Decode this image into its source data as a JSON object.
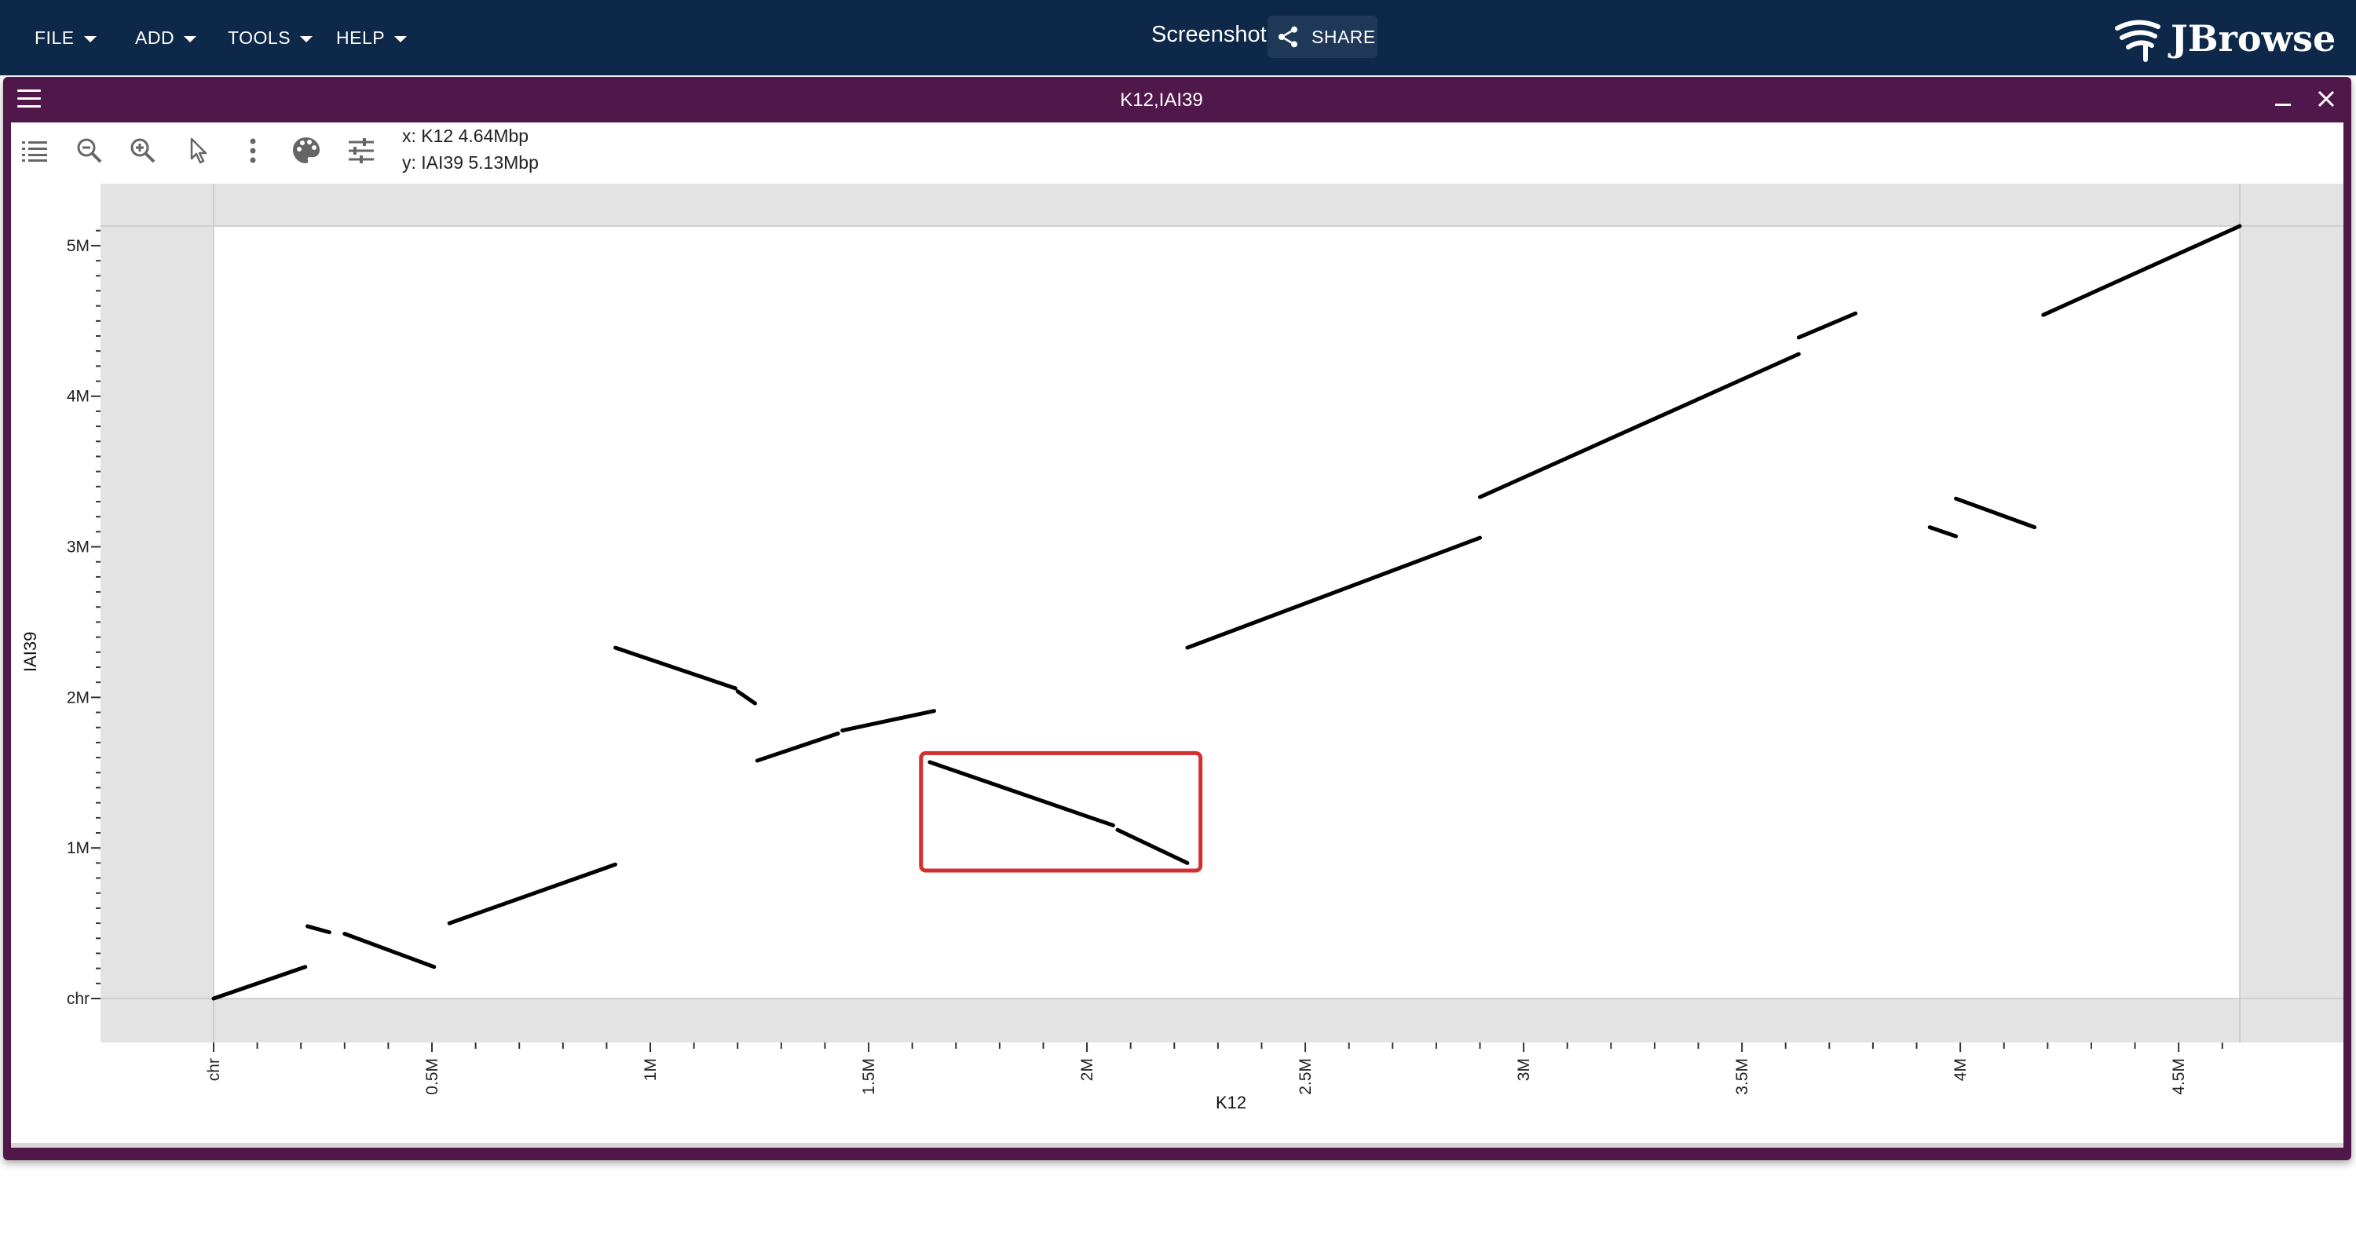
{
  "appbar": {
    "menus": [
      {
        "label": "FILE"
      },
      {
        "label": "ADD"
      },
      {
        "label": "TOOLS"
      },
      {
        "label": "HELP"
      }
    ],
    "session_title": "Screenshot",
    "share_label": "SHARE",
    "logo_text": "JBrowse",
    "background_color": "#0d2849"
  },
  "view": {
    "title": "K12,IAI39",
    "frame_color": "#50184a",
    "toolbar_icons": [
      "track-selector-icon",
      "zoom-out-icon",
      "zoom-in-icon",
      "cursor-mode-icon",
      "more-vert-icon",
      "palette-icon",
      "settings-tune-icon"
    ],
    "coords": {
      "x": "x: K12 4.64Mbp",
      "y": "y: IAI39 5.13Mbp"
    },
    "highlight_color": "#d32f2f"
  },
  "chart_data": {
    "type": "scatter",
    "xlabel": "K12",
    "ylabel": "IAI39",
    "xlim": [
      0,
      4640000
    ],
    "ylim": [
      0,
      5130000
    ],
    "x_ticks": [
      {
        "value": 0,
        "label": "chr"
      },
      {
        "value": 500000,
        "label": "0.5M"
      },
      {
        "value": 1000000,
        "label": "1M"
      },
      {
        "value": 1500000,
        "label": "1.5M"
      },
      {
        "value": 2000000,
        "label": "2M"
      },
      {
        "value": 2500000,
        "label": "2.5M"
      },
      {
        "value": 3000000,
        "label": "3M"
      },
      {
        "value": 3500000,
        "label": "3.5M"
      },
      {
        "value": 4000000,
        "label": "4M"
      },
      {
        "value": 4500000,
        "label": "4.5M"
      }
    ],
    "y_ticks": [
      {
        "value": 0,
        "label": "chr"
      },
      {
        "value": 1000000,
        "label": "1M"
      },
      {
        "value": 2000000,
        "label": "2M"
      },
      {
        "value": 3000000,
        "label": "3M"
      },
      {
        "value": 4000000,
        "label": "4M"
      },
      {
        "value": 5000000,
        "label": "5M"
      }
    ],
    "minor_tick_step": 100000,
    "segments": [
      {
        "x1": 0,
        "y1": 0,
        "x2": 210000,
        "y2": 210000
      },
      {
        "x1": 215000,
        "y1": 480000,
        "x2": 265000,
        "y2": 440000
      },
      {
        "x1": 300000,
        "y1": 430000,
        "x2": 505000,
        "y2": 210000
      },
      {
        "x1": 540000,
        "y1": 500000,
        "x2": 920000,
        "y2": 890000
      },
      {
        "x1": 920000,
        "y1": 2330000,
        "x2": 1195000,
        "y2": 2060000
      },
      {
        "x1": 1200000,
        "y1": 2040000,
        "x2": 1240000,
        "y2": 1960000
      },
      {
        "x1": 1245000,
        "y1": 1580000,
        "x2": 1430000,
        "y2": 1760000
      },
      {
        "x1": 1440000,
        "y1": 1780000,
        "x2": 1650000,
        "y2": 1910000
      },
      {
        "x1": 1640000,
        "y1": 1570000,
        "x2": 2060000,
        "y2": 1150000
      },
      {
        "x1": 2070000,
        "y1": 1120000,
        "x2": 2230000,
        "y2": 900000
      },
      {
        "x1": 2230000,
        "y1": 2330000,
        "x2": 2900000,
        "y2": 3060000
      },
      {
        "x1": 2900000,
        "y1": 3330000,
        "x2": 3630000,
        "y2": 4280000
      },
      {
        "x1": 3630000,
        "y1": 4390000,
        "x2": 3760000,
        "y2": 4550000
      },
      {
        "x1": 3930000,
        "y1": 3130000,
        "x2": 3990000,
        "y2": 3070000
      },
      {
        "x1": 3990000,
        "y1": 3320000,
        "x2": 4170000,
        "y2": 3130000
      },
      {
        "x1": 4190000,
        "y1": 4540000,
        "x2": 4640000,
        "y2": 5130000
      }
    ],
    "selection_box": {
      "x1": 1620000,
      "y1": 850000,
      "x2": 2260000,
      "y2": 1630000
    },
    "grid": false
  }
}
